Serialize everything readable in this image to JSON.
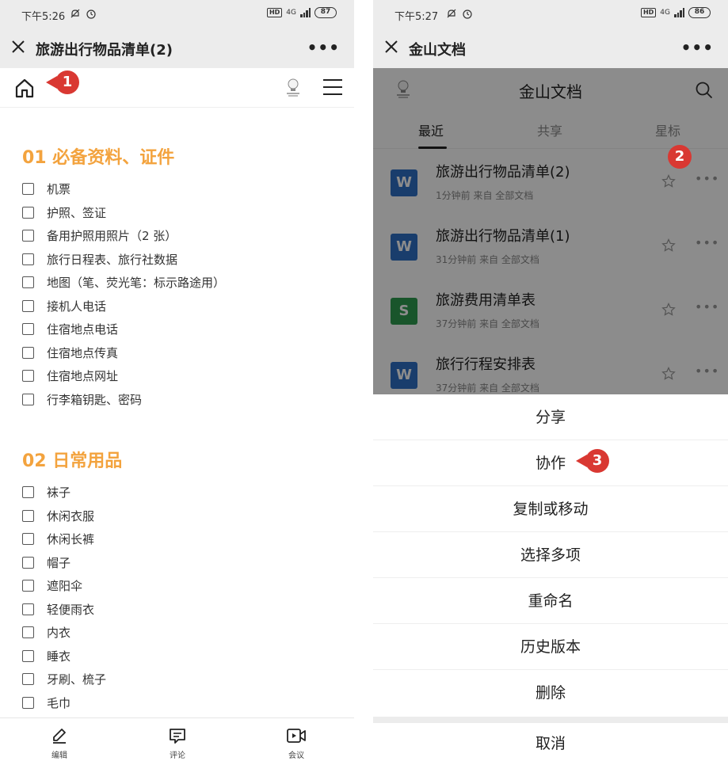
{
  "left": {
    "status": {
      "time": "下午5:26",
      "network": "4G",
      "battery": "87"
    },
    "header": {
      "title": "旅游出行物品清单(2)",
      "more": "•••"
    },
    "callout_1": "1",
    "sections": [
      {
        "title": "01 必备资料、证件",
        "items": [
          "机票",
          "护照、签证",
          "备用护照用照片（2 张）",
          "旅行日程表、旅行社数据",
          "地图（笔、荧光笔：标示路途用）",
          "接机人电话",
          "住宿地点电话",
          "住宿地点传真",
          "住宿地点网址",
          "行李箱钥匙、密码"
        ]
      },
      {
        "title": "02 日常用品",
        "items": [
          "袜子",
          "休闲衣服",
          "休闲长裤",
          "帽子",
          "遮阳伞",
          "轻便雨衣",
          "内衣",
          "睡衣",
          "牙刷、梳子",
          "毛巾"
        ]
      }
    ],
    "bottom": {
      "edit": "编辑",
      "comment": "评论",
      "meeting": "会议"
    }
  },
  "right": {
    "status": {
      "time": "下午5:27",
      "network": "4G",
      "battery": "86"
    },
    "header": {
      "title": "金山文档",
      "more": "•••"
    },
    "app_title": "金山文档",
    "tabs": [
      "最近",
      "共享",
      "星标"
    ],
    "callout_2": "2",
    "callout_3": "3",
    "files": [
      {
        "name": "旅游出行物品清单(2)",
        "meta": "1分钟前  来自 全部文档",
        "type": "W",
        "color": "#2f6fc5"
      },
      {
        "name": "旅游出行物品清单(1)",
        "meta": "31分钟前  来自 全部文档",
        "type": "W",
        "color": "#2f6fc5"
      },
      {
        "name": "旅游费用清单表",
        "meta": "37分钟前  来自 全部文档",
        "type": "S",
        "color": "#2e9b4f"
      },
      {
        "name": "旅行行程安排表",
        "meta": "37分钟前  来自 全部文档",
        "type": "W",
        "color": "#2f6fc5"
      }
    ],
    "sheet": [
      "分享",
      "协作",
      "复制或移动",
      "选择多项",
      "重命名",
      "历史版本",
      "删除"
    ],
    "cancel": "取消"
  }
}
